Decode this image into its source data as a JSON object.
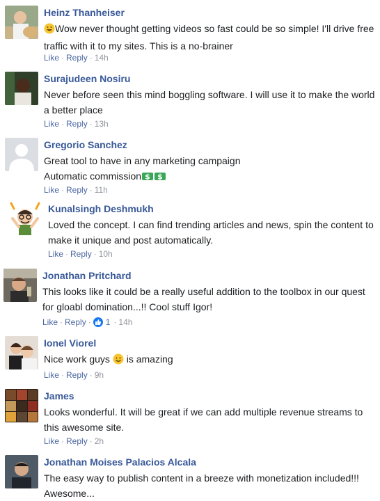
{
  "actions": {
    "like": "Like",
    "reply": "Reply",
    "sep": "·"
  },
  "colors": {
    "name": "#385898",
    "link": "#4b67a1",
    "meta": "#90949c",
    "text": "#1c1e21",
    "like_badge": "#1877f2"
  },
  "comments": [
    {
      "name": "Heinz Thanheiser",
      "lines": [
        "Wow never thought getting videos so fast could be so simple! I'll drive free",
        "traffic with it to my sites. This is a no-brainer"
      ],
      "time": "14h",
      "icons": [
        "grinning-emoji-icon"
      ]
    },
    {
      "name": "Surajudeen Nosiru",
      "lines": [
        "Never before seen this mind boggling software. I will use it to make the world",
        "a better place"
      ],
      "time": "13h"
    },
    {
      "name": "Gregorio Sanchez",
      "lines": [
        "Great tool to have in any marketing campaign",
        "Automatic commission"
      ],
      "time": "11h",
      "icons": [
        "money-bag-icon",
        "money-bag-icon"
      ]
    },
    {
      "name": "Kunalsingh Deshmukh",
      "lines": [
        "Loved the concept. I can find trending articles and news, spin the content to",
        "make it unique and post automatically."
      ],
      "time": "10h"
    },
    {
      "name": "Jonathan Pritchard",
      "lines": [
        "This looks like it could be a really useful addition to the toolbox in our quest",
        "for gloabl domination...!! Cool stuff Igor!"
      ],
      "time": "14h",
      "reactions": "1"
    },
    {
      "name": "Ionel Viorel",
      "lines_before_emoji": "Nice work guys",
      "lines_after_emoji": "is amazing",
      "time": "9h",
      "icons": [
        "smiling-emoji-icon"
      ]
    },
    {
      "name": "James",
      "lines": [
        "Looks wonderful. It will be great if we can add multiple revenue streams to",
        "this awesome site."
      ],
      "time": "2h"
    },
    {
      "name": "Jonathan Moises Palacios Alcala",
      "lines": [
        "The easy way to publish content in a breeze with monetization included!!!",
        "Awesome..."
      ]
    }
  ]
}
